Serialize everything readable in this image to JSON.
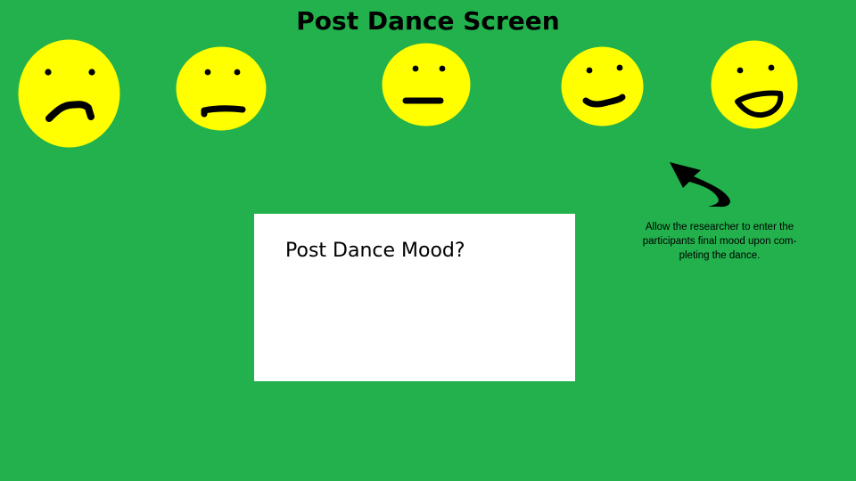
{
  "screen": {
    "title": "Post Dance Screen",
    "background_color": "#22b14c"
  },
  "mood_faces": [
    {
      "mood": "very-sad",
      "icon": "very-sad-face-icon",
      "color": "#ffff00"
    },
    {
      "mood": "sad",
      "icon": "sad-face-icon",
      "color": "#ffff00"
    },
    {
      "mood": "neutral",
      "icon": "neutral-face-icon",
      "color": "#ffff00"
    },
    {
      "mood": "happy",
      "icon": "happy-face-icon",
      "color": "#ffff00"
    },
    {
      "mood": "very-happy",
      "icon": "very-happy-face-icon",
      "color": "#ffff00"
    }
  ],
  "mood_box": {
    "label": "Post Dance Mood?",
    "background_color": "#ffffff"
  },
  "annotation": {
    "icon": "curved-arrow-icon",
    "lines": [
      "Allow the researcher to enter the",
      "participants final mood upon com-",
      "pleting the dance."
    ]
  }
}
